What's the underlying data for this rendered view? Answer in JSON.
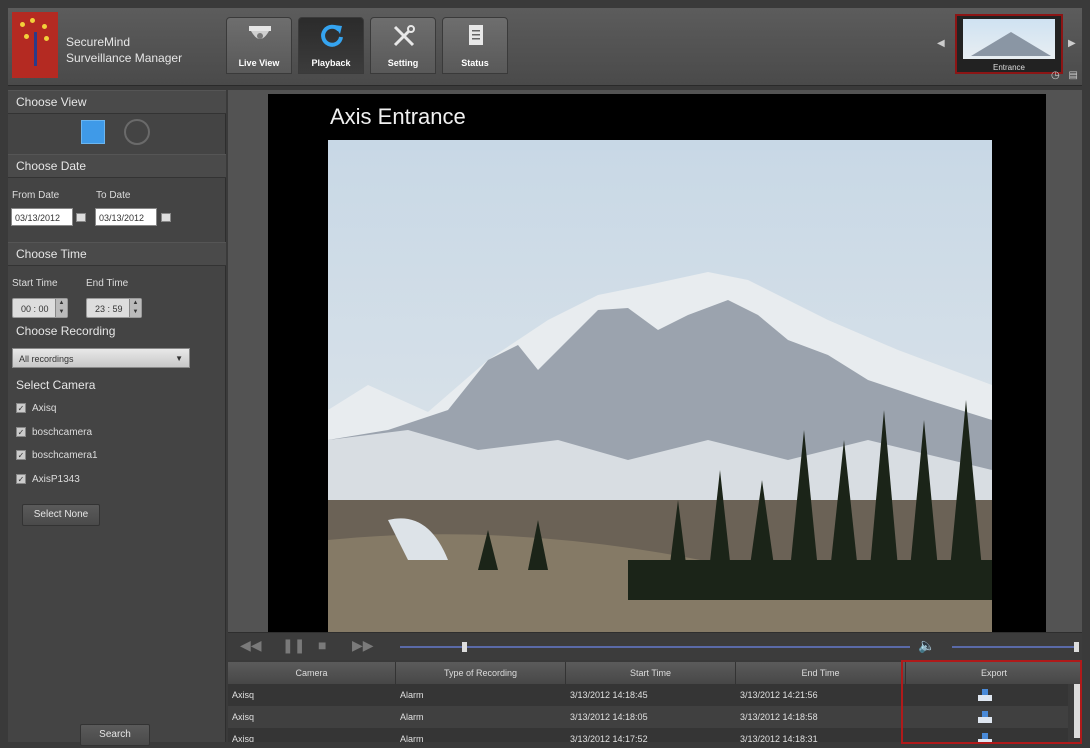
{
  "header": {
    "brand_line1": "SecureMind",
    "brand_line2": "Surveillance Manager",
    "tabs": [
      {
        "label": "Live View",
        "icon": "dome-camera-icon",
        "active": false
      },
      {
        "label": "Playback",
        "icon": "refresh-icon",
        "active": true
      },
      {
        "label": "Setting",
        "icon": "tools-icon",
        "active": false
      },
      {
        "label": "Status",
        "icon": "document-icon",
        "active": false
      }
    ],
    "thumbnail_label": "Entrance",
    "accent_color": "#3f9ae8",
    "highlight_color": "#b01a1a"
  },
  "sidebar": {
    "choose_view": "Choose View",
    "choose_date": "Choose Date",
    "from_date_label": "From Date",
    "to_date_label": "To Date",
    "from_date": "03/13/2012",
    "to_date": "03/13/2012",
    "choose_time": "Choose Time",
    "start_time_label": "Start Time",
    "end_time_label": "End Time",
    "start_time": "00 : 00",
    "end_time": "23 : 59",
    "choose_recording": "Choose Recording",
    "recording_selected": "All recordings",
    "select_camera": "Select Camera",
    "cameras": [
      "Axisq",
      "boschcamera",
      "boschcamera1",
      "AxisP1343"
    ],
    "select_none": "Select None",
    "search": "Search"
  },
  "video": {
    "title": "Axis Entrance"
  },
  "table": {
    "headers": [
      "Camera",
      "Type of Recording",
      "Start Time",
      "End Time",
      "Export"
    ],
    "rows": [
      {
        "camera": "Axisq",
        "type": "Alarm",
        "start": "3/13/2012 14:18:45",
        "end": "3/13/2012 14:21:56"
      },
      {
        "camera": "Axisq",
        "type": "Alarm",
        "start": "3/13/2012 14:18:05",
        "end": "3/13/2012 14:18:58"
      },
      {
        "camera": "Axisq",
        "type": "Alarm",
        "start": "3/13/2012 14:17:52",
        "end": "3/13/2012 14:18:31"
      }
    ]
  }
}
